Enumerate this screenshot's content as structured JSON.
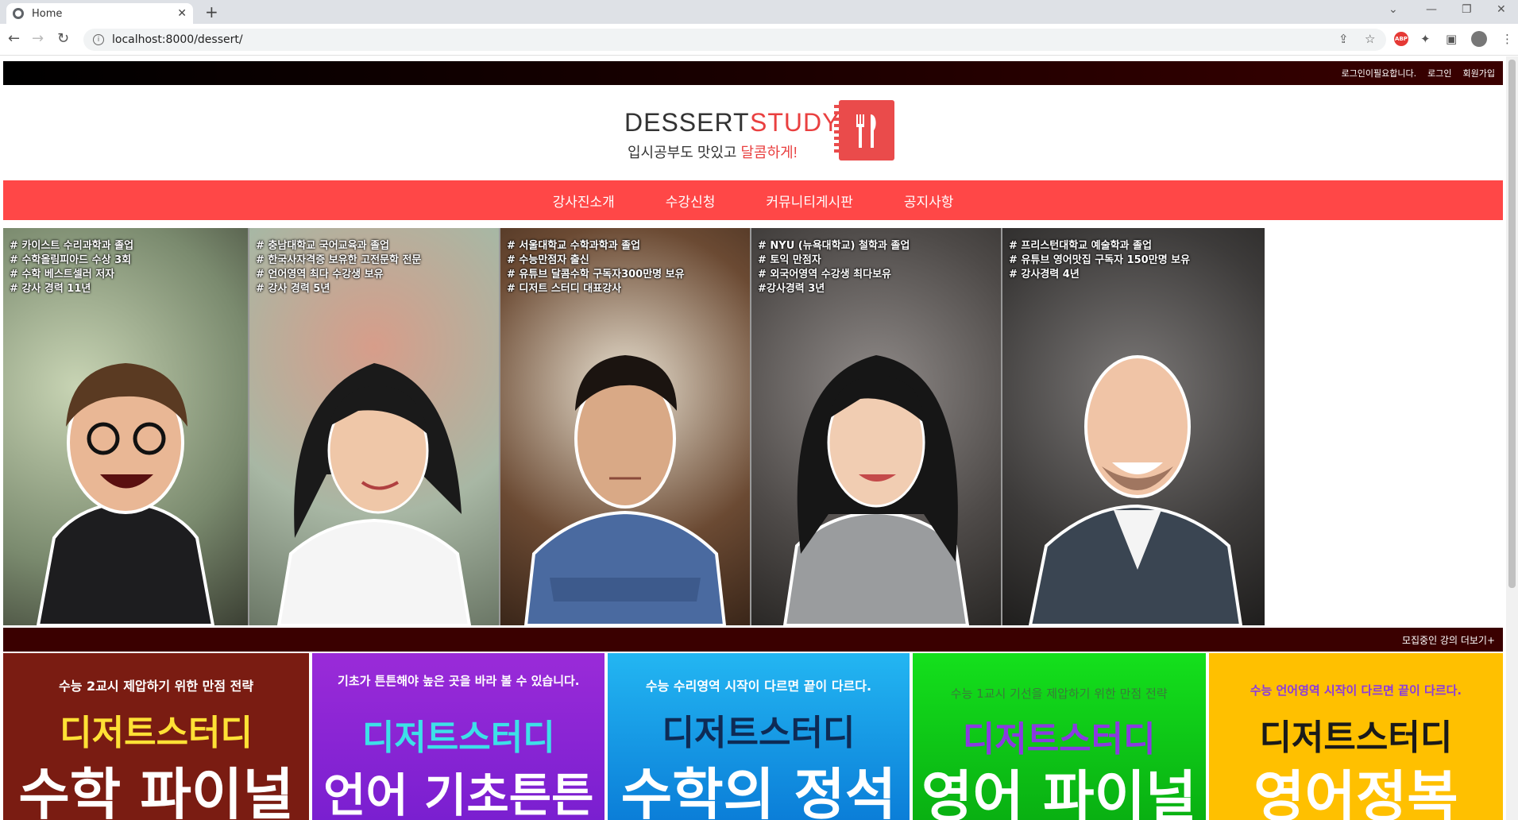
{
  "browser": {
    "tab_title": "Home",
    "url": "localhost:8000/dessert/"
  },
  "topbar": {
    "status": "로그인이필요합니다.",
    "login": "로그인",
    "signup": "회원가입"
  },
  "logo": {
    "word1": "DESSERT",
    "word2": "STUDY",
    "tag_a": "입시공부도 ",
    "tag_b": "맛있고 ",
    "tag_c": "달콤하게!"
  },
  "nav": [
    "강사진소개",
    "수강신청",
    "커뮤니티게시판",
    "공지사항"
  ],
  "teachers": [
    {
      "lines": [
        "# 카이스트 수리과학과 졸업",
        "# 수학올림피아드 수상 3회",
        "# 수학 베스트셀러 저자",
        "# 강사 경력 11년"
      ]
    },
    {
      "lines": [
        "# 충남대학교 국어교육과 졸업",
        "# 한국사자격증 보유한 고전문학 전문",
        "# 언어영역 최다 수강생 보유",
        "# 강사 경력 5년"
      ]
    },
    {
      "lines": [
        "# 서울대학교 수학과학과 졸업",
        "# 수능만점자 출신",
        "# 유튜브 달콤수학 구독자300만명 보유",
        "# 디저트 스터디 대표강사"
      ]
    },
    {
      "lines": [
        "# NYU (뉴욕대학교) 철학과 졸업",
        "# 토익 만점자",
        "# 외국어영역 수강생 최다보유",
        "#강사경력 3년"
      ]
    },
    {
      "lines": [
        "# 프리스턴대학교 예술학과 졸업",
        "# 유튜브 영어맛집 구독자 150만명 보유",
        "# 강사경력 4년"
      ]
    }
  ],
  "more": "모집중인 강의 더보기+",
  "courses": [
    {
      "sub": "수능 2교시 제압하기 위한 만점 전략",
      "brand": "디저트스터디",
      "title": "수학 파이널"
    },
    {
      "sub": "기초가 튼튼해야 높은 곳을 바라 볼 수 있습니다.",
      "brand": "디저트스터디",
      "title": "언어 기초튼튼"
    },
    {
      "sub": "수능 수리영역 시작이 다르면 끝이 다르다.",
      "brand": "디저트스터디",
      "title": "수학의 정석"
    },
    {
      "sub": "수능 1교시 기선을 제압하기 위한 만점 전략",
      "brand": "디저트스터디",
      "title": "영어 파이널"
    },
    {
      "sub": "수능 언어영역 시작이 다르면 끝이 다르다.",
      "brand": "디저트스터디",
      "title": "영어정복"
    }
  ],
  "colors": {
    "nav_bg": "#ff4747",
    "brand_red": "#e94040",
    "topbar_dark": "#3a0000"
  }
}
